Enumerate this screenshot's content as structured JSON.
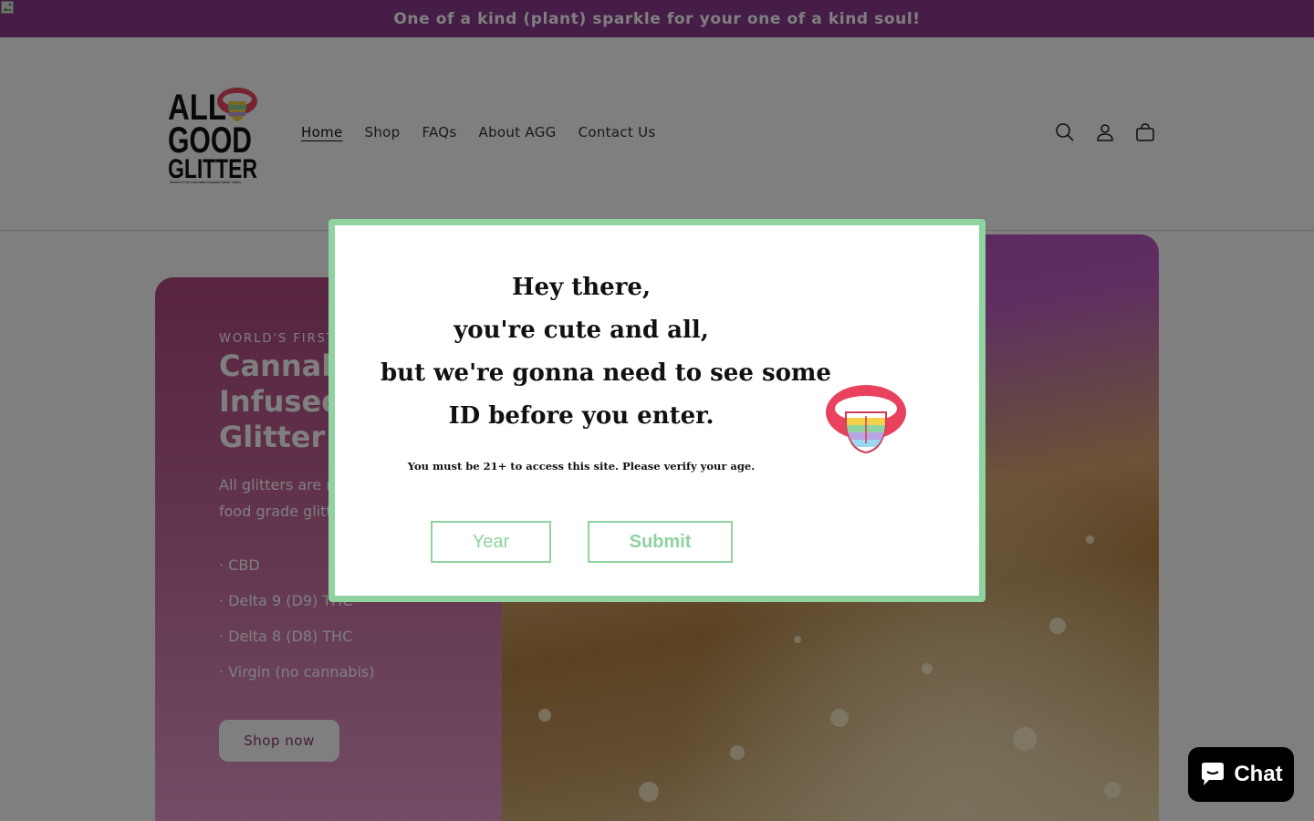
{
  "announcement": {
    "text": "One of a kind (plant) sparkle for your one of a kind soul!"
  },
  "header": {
    "logo": {
      "lines": [
        "ALL",
        "GOOD",
        "GLITTER"
      ],
      "tagline": "World's First Cannabis Infused Edible Glitter"
    },
    "nav": [
      {
        "label": "Home",
        "active": true
      },
      {
        "label": "Shop"
      },
      {
        "label": "FAQs"
      },
      {
        "label": "About AGG"
      },
      {
        "label": "Contact Us"
      }
    ],
    "icons": [
      "search-icon",
      "account-icon",
      "cart-icon"
    ]
  },
  "hero": {
    "eyebrow": "WORLD'S FIRST",
    "title": "Cannabis Infused Edible Glitter ™",
    "description": "All glitters are made with edible, food grade glitter. Choose from:",
    "options": [
      "· CBD",
      "· Delta 9 (D9) THC",
      "· Delta 8 (D8) THC",
      "· Virgin (no cannabis)"
    ],
    "button_label": "Shop now"
  },
  "age_gate": {
    "heading_lines": [
      "Hey there,",
      "you're cute and all,",
      "but we're gonna need to see some",
      "ID before you enter."
    ],
    "note": "You must be 21+ to access this site. Please verify your age.",
    "year_placeholder": "Year",
    "submit_label": "Submit",
    "accent_color": "#8fd3a0"
  },
  "chat": {
    "label": "Chat"
  },
  "colors": {
    "announcement_bg": "#8a3a8f",
    "hero_card": "#b0487e"
  }
}
